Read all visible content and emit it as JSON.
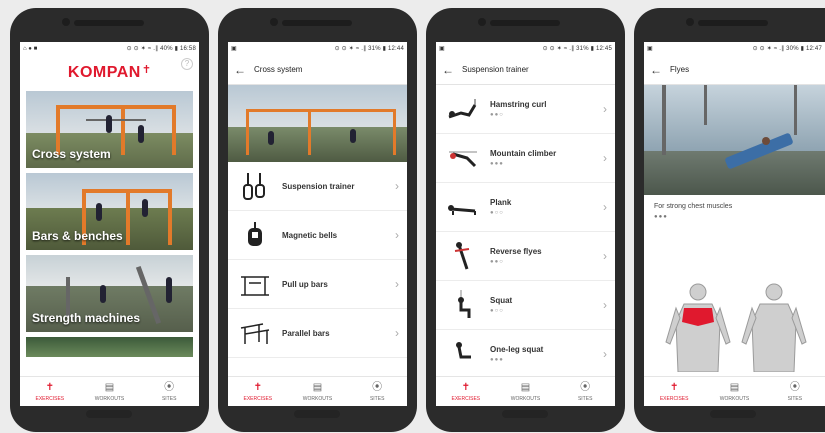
{
  "colors": {
    "brand": "#e0192e",
    "equipment": "#e27a2a"
  },
  "screen1": {
    "status": {
      "left": "⌂ ● ■",
      "right": "⊙ ⊙ ✶ ≈ .∥ 40% ▮ 16:58"
    },
    "logo": "KOMPAN",
    "help": "?",
    "categories": [
      {
        "label": "Cross system"
      },
      {
        "label": "Bars & benches"
      },
      {
        "label": "Strength machines"
      }
    ]
  },
  "screen2": {
    "status": {
      "left": "▣",
      "right": "⊙ ⊙ ✶ ≈ .∥ 31% ▮ 12:44"
    },
    "title": "Cross system",
    "items": [
      {
        "name": "Suspension trainer",
        "icon": "suspension-trainer-icon"
      },
      {
        "name": "Magnetic bells",
        "icon": "magnetic-bells-icon"
      },
      {
        "name": "Pull up bars",
        "icon": "pull-up-bars-icon"
      },
      {
        "name": "Parallel bars",
        "icon": "parallel-bars-icon"
      }
    ]
  },
  "screen3": {
    "status": {
      "left": "▣",
      "right": "⊙ ⊙ ✶ ≈ .∥ 31% ▮ 12:45"
    },
    "title": "Suspension trainer",
    "items": [
      {
        "name": "Hamstring curl",
        "dots": "●●○"
      },
      {
        "name": "Mountain climber",
        "dots": "●●●"
      },
      {
        "name": "Plank",
        "dots": "●○○"
      },
      {
        "name": "Reverse flyes",
        "dots": "●●○"
      },
      {
        "name": "Squat",
        "dots": "●○○"
      },
      {
        "name": "One-leg squat",
        "dots": "●●●"
      }
    ]
  },
  "screen4": {
    "status": {
      "left": "▣",
      "right": "⊙ ⊙ ✶ ≈ .∥ 30% ▮ 12:47"
    },
    "title": "Flyes",
    "description": "For strong chest muscles",
    "dots": "●●●"
  },
  "nav": {
    "exercises": "EXERCISES",
    "workouts": "WORKOUTS",
    "sites": "SITES"
  }
}
